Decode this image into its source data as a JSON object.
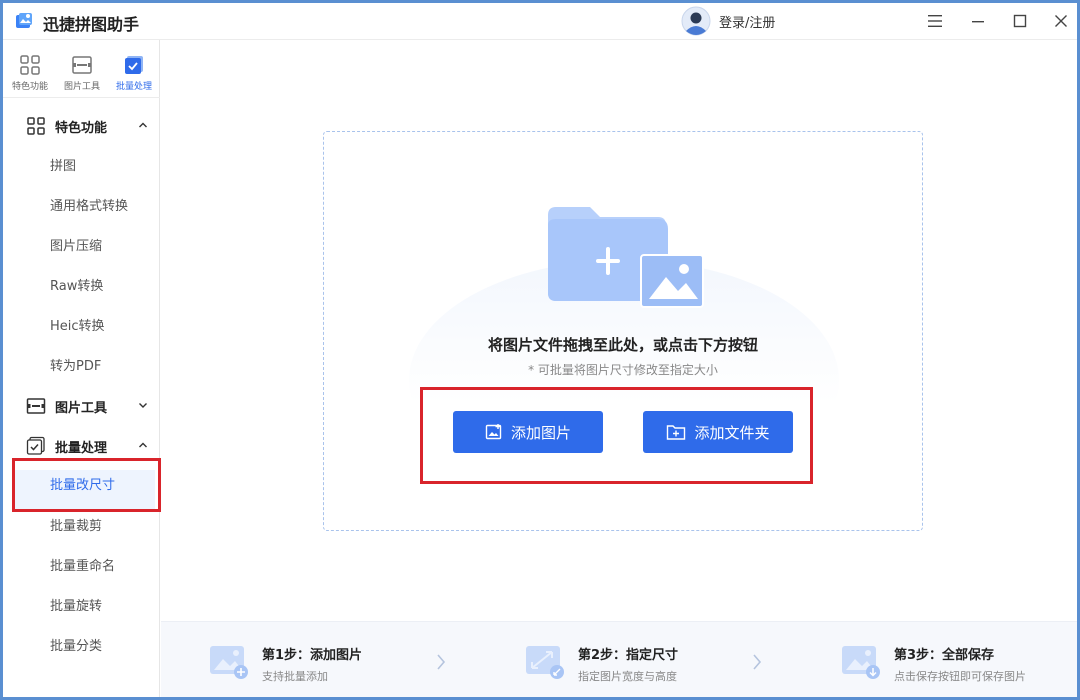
{
  "app": {
    "title": "迅捷拼图助手",
    "login_label": "登录/注册",
    "accent_color": "#2f6bea"
  },
  "sidebar": {
    "top_tabs": [
      {
        "label": "特色功能",
        "icon": "grid-icon"
      },
      {
        "label": "图片工具",
        "icon": "image-tool-icon"
      },
      {
        "label": "批量处理",
        "icon": "batch-check-icon",
        "active": true
      }
    ],
    "groups": [
      {
        "label": "特色功能",
        "icon": "grid-icon",
        "expanded": true,
        "items": [
          "拼图",
          "通用格式转换",
          "图片压缩",
          "Raw转换",
          "Heic转换",
          "转为PDF"
        ]
      },
      {
        "label": "图片工具",
        "icon": "image-tool-icon",
        "expanded": false,
        "items": []
      },
      {
        "label": "批量处理",
        "icon": "batch-check-icon",
        "expanded": true,
        "items": [
          "批量改尺寸",
          "批量裁剪",
          "批量重命名",
          "批量旋转",
          "批量分类"
        ],
        "active_item": "批量改尺寸"
      }
    ]
  },
  "dropzone": {
    "main_text": "将图片文件拖拽至此处，或点击下方按钮",
    "sub_text": "* 可批量将图片尺寸修改至指定大小",
    "add_image_label": "添加图片",
    "add_folder_label": "添加文件夹"
  },
  "steps": [
    {
      "title": "第1步：添加图片",
      "desc": "支持批量添加"
    },
    {
      "title": "第2步：指定尺寸",
      "desc": "指定图片宽度与高度"
    },
    {
      "title": "第3步：全部保存",
      "desc": "点击保存按钮即可保存图片"
    }
  ]
}
